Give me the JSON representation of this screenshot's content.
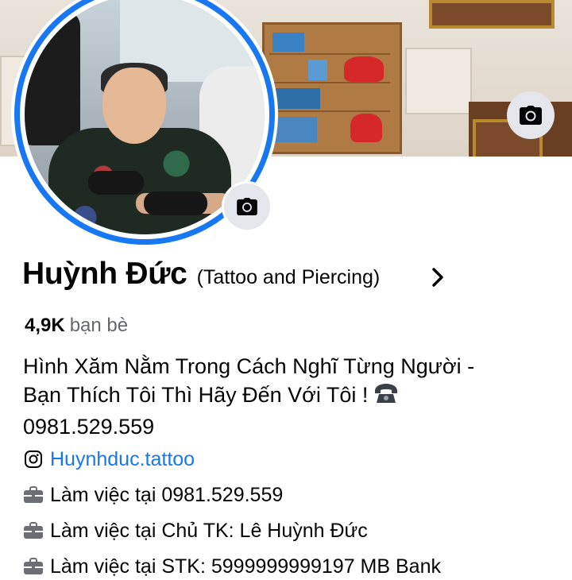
{
  "profile": {
    "name": "Huỳnh Đức",
    "alternate_name": "(Tattoo and Piercing)",
    "friends_count": "4,9K",
    "friends_label": "bạn bè",
    "bio_lines": [
      "Hình Xăm Nằm Trong Cách Nghĩ Từng Người -",
      "Bạn Thích Tôi Thì Hãy Đến Với Tôi !",
      "0981.529.559"
    ]
  },
  "details": [
    {
      "icon": "instagram-icon",
      "text": "Huynhduc.tattoo",
      "is_link": true
    },
    {
      "icon": "briefcase-icon",
      "prefix": "Làm việc tại",
      "text": "0981.529.559"
    },
    {
      "icon": "briefcase-icon",
      "prefix": "Làm việc tại",
      "text": "Chủ TK: Lê Huỳnh Đức"
    },
    {
      "icon": "briefcase-icon",
      "prefix": "Làm việc tại",
      "text": "STK: 5999999999197 MB Bank"
    }
  ],
  "colors": {
    "accent": "#1877f2",
    "secondary_text": "#65676b",
    "button_bg": "#e4e6eb"
  }
}
